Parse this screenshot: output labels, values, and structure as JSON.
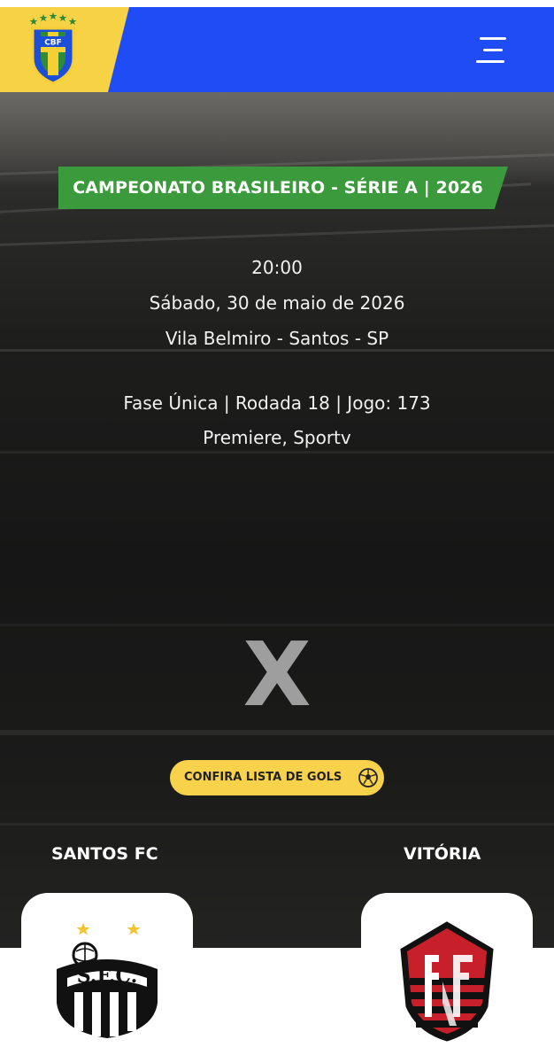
{
  "header": {
    "logo_text": "CBF",
    "colors": {
      "bar": "#1f4cf5",
      "logo_area": "#f7d244"
    },
    "menu_icon": "hamburger-menu-icon"
  },
  "match": {
    "competition": "CAMPEONATO BRASILEIRO - SÉRIE A | 2026",
    "time": "20:00",
    "date": "Sábado, 30 de maio de 2026",
    "venue": "Vila Belmiro - Santos - SP",
    "round_info": "Fase Única | Rodada 18 | Jogo: 173",
    "broadcast": "Premiere, Sportv",
    "versus": "X",
    "goals_button": "CONFIRA LISTA DE GOLS",
    "goals_icon": "soccer-ball-icon"
  },
  "teams": {
    "home": {
      "name": "SANTOS FC",
      "badge_text": "S.F.C."
    },
    "away": {
      "name": "VITÓRIA"
    }
  },
  "colors": {
    "competition_banner": "#3b9a3b",
    "goals_button": "#f8d24a",
    "vitoria_red": "#c8202a"
  }
}
